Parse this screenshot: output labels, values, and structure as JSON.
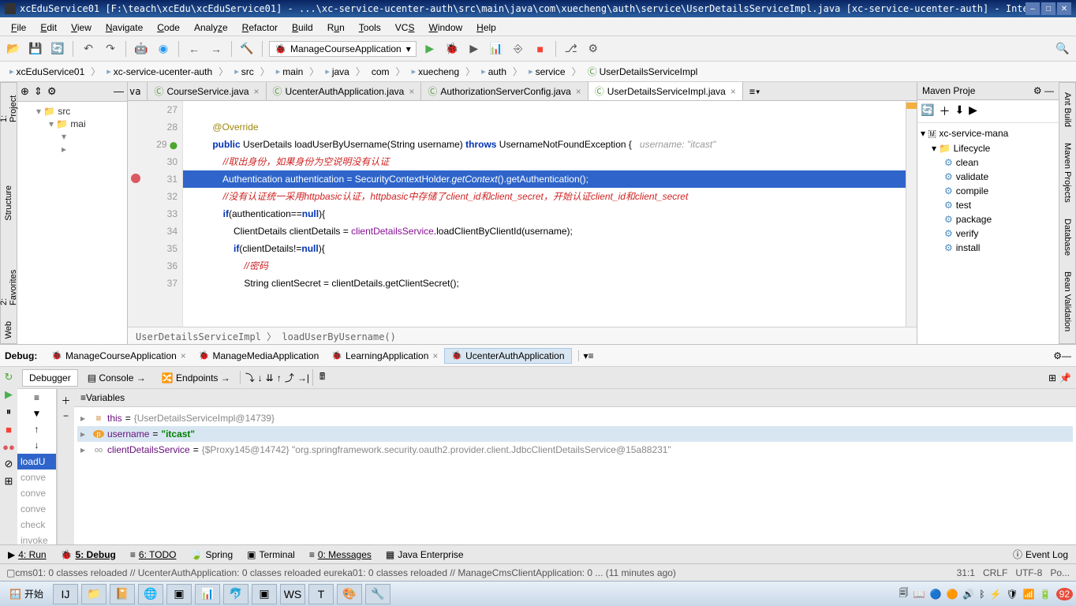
{
  "titlebar": "xcEduService01 [F:\\teach\\xcEdu\\xcEduService01] - ...\\xc-service-ucenter-auth\\src\\main\\java\\com\\xuecheng\\auth\\service\\UserDetailsServiceImpl.java [xc-service-ucenter-auth] - IntelliJ...",
  "menu": {
    "file": "File",
    "edit": "Edit",
    "view": "View",
    "navigate": "Navigate",
    "code": "Code",
    "analyze": "Analyze",
    "refactor": "Refactor",
    "build": "Build",
    "run": "Run",
    "tools": "Tools",
    "vcs": "VCS",
    "window": "Window",
    "help": "Help"
  },
  "run_config": "ManageCourseApplication",
  "breadcrumbs": [
    "xcEduService01",
    "xc-service-ucenter-auth",
    "src",
    "main",
    "java",
    "com",
    "xuecheng",
    "auth",
    "service",
    "UserDetailsServiceImpl"
  ],
  "project_tree": {
    "src": "src",
    "mai": "mai"
  },
  "editor_tabs": [
    {
      "label": "CourseService.java",
      "active": false,
      "prefix": "va"
    },
    {
      "label": "UcenterAuthApplication.java",
      "active": false
    },
    {
      "label": "AuthorizationServerConfig.java",
      "active": false
    },
    {
      "label": "UserDetailsServiceImpl.java",
      "active": true
    }
  ],
  "gutter_lines": [
    "27",
    "28",
    "29",
    "30",
    "31",
    "32",
    "33",
    "34",
    "35",
    "36",
    "37"
  ],
  "code": {
    "l28": "@Override",
    "l29_public": "public",
    "l29_type": " UserDetails loadUserByUsername(String username) ",
    "l29_throws": "throws",
    "l29_ex": " UsernameNotFoundException {   ",
    "l29_hint": "username: \"itcast\"",
    "l30": "//取出身份，如果身份为空说明没有认证",
    "l31_a": "Authentication authentication = SecurityContextHolder.",
    "l31_b": "getContext",
    "l31_c": "().getAuthentication();",
    "l32_a": "//没有认证统一采用",
    "l32_b": "httpbasic",
    "l32_c": "认证，",
    "l32_d": "httpbasic",
    "l32_e": "中存储了",
    "l32_f": "client_id",
    "l32_g": "和",
    "l32_h": "client_secret",
    "l32_i": "，开始认证",
    "l32_j": "client_id",
    "l32_k": "和",
    "l32_l": "client_secret",
    "l33_a": "if",
    "l33_b": "(authentication==",
    "l33_c": "null",
    "l33_d": "){",
    "l34_a": "ClientDetails clientDetails = ",
    "l34_b": "clientDetailsService",
    "l34_c": ".loadClientByClientId(username);",
    "l35_a": "if",
    "l35_b": "(clientDetails!=",
    "l35_c": "null",
    "l35_d": "){",
    "l36": "//密码",
    "l37": "String clientSecret = clientDetails.getClientSecret();"
  },
  "code_breadcrumb": "UserDetailsServiceImpl 〉 loadUserByUsername()",
  "maven": {
    "title": "Maven Proje",
    "root": "xc-service-mana",
    "lifecycle": "Lifecycle",
    "goals": [
      "clean",
      "validate",
      "compile",
      "test",
      "package",
      "verify",
      "install"
    ]
  },
  "debug": {
    "label": "Debug:",
    "tabs": [
      {
        "label": "ManageCourseApplication"
      },
      {
        "label": "ManageMediaApplication"
      },
      {
        "label": "LearningApplication"
      },
      {
        "label": "UcenterAuthApplication",
        "active": true
      }
    ],
    "debugger": "Debugger",
    "console": "Console",
    "endpoints": "Endpoints",
    "frames": [
      "loadU",
      "conve",
      "conve",
      "conve",
      "check",
      "invoke"
    ],
    "vars_title": "Variables",
    "vars": [
      {
        "name": "this",
        "val": "{UserDetailsServiceImpl@14739}",
        "icon": "≡"
      },
      {
        "name": "username",
        "val": "\"itcast\"",
        "icon": "p",
        "sel": true,
        "str": true
      },
      {
        "name": "clientDetailsService",
        "val": "{$Proxy145@14742} \"org.springframework.security.oauth2.provider.client.JdbcClientDetailsService@15a88231\"",
        "icon": "oo"
      }
    ]
  },
  "bottom_tabs": {
    "run": "4: Run",
    "debug": "5: Debug",
    "todo": "6: TODO",
    "spring": "Spring",
    "terminal": "Terminal",
    "messages": "0: Messages",
    "enterprise": "Java Enterprise",
    "eventlog": "Event Log"
  },
  "status": {
    "msg": "cms01: 0 classes reloaded // UcenterAuthApplication: 0 classes reloaded eureka01: 0 classes reloaded // ManageCmsClientApplication: 0 ... (11 minutes ago)",
    "pos": "31:1",
    "crlf": "CRLF",
    "enc": "UTF-8",
    "po": "Po..."
  },
  "left_tabs": {
    "project": "1: Project",
    "structure": "Structure",
    "favorites": "2: Favorites",
    "web": "Web"
  },
  "right_tabs": {
    "ant": "Ant Build",
    "maven": "Maven Projects",
    "database": "Database",
    "bean": "Bean Validation"
  },
  "taskbar": {
    "start": "开始",
    "time": "92"
  }
}
